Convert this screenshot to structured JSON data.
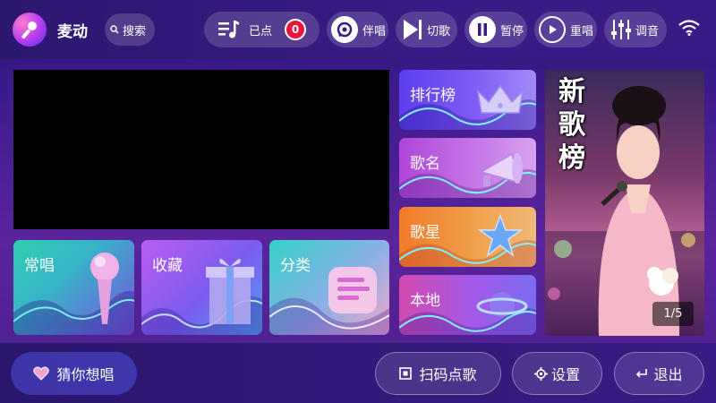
{
  "header": {
    "app_title": "麦动",
    "search_label": "搜索",
    "queued_label": "已点",
    "queued_count": "0",
    "controls": [
      {
        "label": "伴唱",
        "icon": "vocal-toggle-icon"
      },
      {
        "label": "切歌",
        "icon": "skip-next-icon"
      },
      {
        "label": "暂停",
        "icon": "pause-icon"
      },
      {
        "label": "重唱",
        "icon": "replay-icon"
      },
      {
        "label": "调音",
        "icon": "equalizer-icon"
      }
    ],
    "status_icon": "wifi-icon"
  },
  "tiles": {
    "chang": "常唱",
    "shoucang": "收藏",
    "fenlei": "分类",
    "paihang": "排行榜",
    "geming": "歌名",
    "gexing": "歌星",
    "bendi": "本地"
  },
  "poster": {
    "title_chars": [
      "新",
      "歌",
      "榜"
    ],
    "pager": "1/5"
  },
  "footer": {
    "guess_label": "猜你想唱",
    "scan_label": "扫码点歌",
    "settings_label": "设置",
    "exit_label": "退出"
  },
  "colors": {
    "accent_red": "#e8173e",
    "background": "#3b1a8a"
  }
}
